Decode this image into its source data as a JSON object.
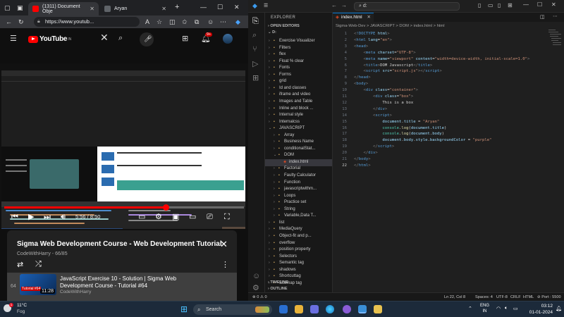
{
  "browser": {
    "tabs": [
      {
        "label": "(1311) Document Obje",
        "fav_color": "#ff0000"
      },
      {
        "label": "Aryan",
        "fav_color": "#888888"
      }
    ],
    "new_tab": "+",
    "window_buttons": {
      "minimize": "—",
      "maximize": "☐",
      "close": "✕"
    },
    "url": "https://www.youtub..."
  },
  "youtube": {
    "logo_text": "YouTube",
    "logo_country": "IN",
    "notification_count": "9+",
    "player": {
      "time": "5:56 / 8:50",
      "progress": 0.674
    },
    "playlist": {
      "title": "Sigma Web Development Course - Web Development Tutorial...",
      "channel_index": "CodeWithHarry - 66/85",
      "item": {
        "index": "64",
        "title": "JavaScript Exercise 10 - Solution | Sigma Web Development Course - Tutorial #64",
        "channel": "CodeWithHarry",
        "duration": "11:28",
        "thumb_text": "Tutorial #64"
      }
    }
  },
  "vscode": {
    "search": "d:",
    "explorer_label": "EXPLORER",
    "open_editors": "OPEN EDITORS",
    "root": "D:",
    "tree": [
      {
        "label": "Exercise Visualizer",
        "level": 1,
        "type": "folder"
      },
      {
        "label": "Filters",
        "level": 1,
        "type": "folder"
      },
      {
        "label": "flex",
        "level": 1,
        "type": "folder"
      },
      {
        "label": "Float % clear",
        "level": 1,
        "type": "folder"
      },
      {
        "label": "Fonts",
        "level": 1,
        "type": "folder"
      },
      {
        "label": "Forms",
        "level": 1,
        "type": "folder"
      },
      {
        "label": "grid",
        "level": 1,
        "type": "folder"
      },
      {
        "label": "Id and classes",
        "level": 1,
        "type": "folder"
      },
      {
        "label": "iframe and video",
        "level": 1,
        "type": "folder"
      },
      {
        "label": "Images and Table",
        "level": 1,
        "type": "folder"
      },
      {
        "label": "Inline and block ...",
        "level": 1,
        "type": "folder"
      },
      {
        "label": "Internal style",
        "level": 1,
        "type": "folder"
      },
      {
        "label": "Internalcss",
        "level": 1,
        "type": "folder"
      },
      {
        "label": "JAVASCRIPT",
        "level": 1,
        "type": "folder-open"
      },
      {
        "label": "Array",
        "level": 2,
        "type": "folder"
      },
      {
        "label": "Business Name",
        "level": 2,
        "type": "folder"
      },
      {
        "label": "conditionalStat...",
        "level": 2,
        "type": "folder"
      },
      {
        "label": "DOM",
        "level": 2,
        "type": "folder-open"
      },
      {
        "label": "index.html",
        "level": 3,
        "type": "html",
        "selected": true
      },
      {
        "label": "Factorial",
        "level": 2,
        "type": "folder"
      },
      {
        "label": "Faulty Calculator",
        "level": 2,
        "type": "folder"
      },
      {
        "label": "Function",
        "level": 2,
        "type": "folder"
      },
      {
        "label": "javascriptwithm...",
        "level": 2,
        "type": "folder"
      },
      {
        "label": "Loops",
        "level": 2,
        "type": "folder"
      },
      {
        "label": "Practice set",
        "level": 2,
        "type": "folder"
      },
      {
        "label": "String",
        "level": 2,
        "type": "folder"
      },
      {
        "label": "Variable,Data T...",
        "level": 2,
        "type": "folder"
      },
      {
        "label": "list",
        "level": 1,
        "type": "folder"
      },
      {
        "label": "MediaQuery",
        "level": 1,
        "type": "folder"
      },
      {
        "label": "Object-fit and p...",
        "level": 1,
        "type": "folder"
      },
      {
        "label": "overflow",
        "level": 1,
        "type": "folder"
      },
      {
        "label": "position property",
        "level": 1,
        "type": "folder"
      },
      {
        "label": "Selectors",
        "level": 1,
        "type": "folder"
      },
      {
        "label": "Semantic tag",
        "level": 1,
        "type": "folder"
      },
      {
        "label": "shadows",
        "level": 1,
        "type": "folder"
      },
      {
        "label": "Shortcuttag",
        "level": 1,
        "type": "folder"
      },
      {
        "label": "Sitemap tag",
        "level": 1,
        "type": "folder"
      }
    ],
    "timeline": "TIMELINE",
    "outline": "OUTLINE",
    "editor_tab": "index.html",
    "breadcrumbs": "Sigma-Web-Dev > JAVASCRIPT > DOM > index.html > html",
    "code": [
      {
        "n": "1",
        "html": "<span class='p'>&lt;</span><span class='t'>!DOCTYPE</span> <span class='a'>html</span><span class='p'>&gt;</span>"
      },
      {
        "n": "2",
        "html": "<span class='p'>&lt;</span><span class='t'>html</span> <span class='a'>lang</span><span class='tx'>=</span><span class='s'>\"en\"</span><span class='p'>&gt;</span>"
      },
      {
        "n": "3",
        "html": "<span class='p'>&lt;</span><span class='t'>head</span><span class='p'>&gt;</span>"
      },
      {
        "n": "4",
        "html": "    <span class='p'>&lt;</span><span class='t'>meta</span> <span class='a'>charset</span><span class='tx'>=</span><span class='s'>\"UTF-8\"</span><span class='p'>&gt;</span>"
      },
      {
        "n": "5",
        "html": "    <span class='p'>&lt;</span><span class='t'>meta</span> <span class='a'>name</span><span class='tx'>=</span><span class='s'>\"viewport\"</span> <span class='a'>content</span><span class='tx'>=</span><span class='s'>\"width=device-width, initial-scale=1.0\"</span><span class='p'>&gt;</span>"
      },
      {
        "n": "6",
        "html": "    <span class='p'>&lt;</span><span class='t'>title</span><span class='p'>&gt;</span><span class='tx'>DOM Javascript</span><span class='p'>&lt;/</span><span class='t'>title</span><span class='p'>&gt;</span>"
      },
      {
        "n": "7",
        "html": "    <span class='p'>&lt;</span><span class='t'>script</span> <span class='a'>src</span><span class='tx'>=</span><span class='s'>\"script.js\"</span><span class='p'>&gt;&lt;/</span><span class='t'>script</span><span class='p'>&gt;</span>"
      },
      {
        "n": "8",
        "html": "<span class='p'>&lt;/</span><span class='t'>head</span><span class='p'>&gt;</span>"
      },
      {
        "n": "9",
        "html": "<span class='p'>&lt;</span><span class='t'>body</span><span class='p'>&gt;</span>"
      },
      {
        "n": "10",
        "html": "    <span class='p'>&lt;</span><span class='t'>div</span> <span class='a'>class</span><span class='tx'>=</span><span class='s'>\"container\"</span><span class='p'>&gt;</span>"
      },
      {
        "n": "11",
        "html": "        <span class='p'>&lt;</span><span class='t'>div</span> <span class='a'>class</span><span class='tx'>=</span><span class='s'>\"box\"</span><span class='p'>&gt;</span>"
      },
      {
        "n": "12",
        "html": "            <span class='tx'>This is a box</span>"
      },
      {
        "n": "13",
        "html": "        <span class='p'>&lt;/</span><span class='t'>div</span><span class='p'>&gt;</span>"
      },
      {
        "n": "14",
        "html": "        <span class='p'>&lt;</span><span class='t'>script</span><span class='p'>&gt;</span>"
      },
      {
        "n": "15",
        "html": "            <span class='a'>document</span><span class='tx'>.</span><span class='a'>title</span> <span class='tx'>=</span> <span class='s'>\"Aryan\"</span>"
      },
      {
        "n": "16",
        "html": "            <span class='k'>console</span><span class='tx'>.</span><span class='y'>log</span><span class='tx'>(</span><span class='a'>document</span><span class='tx'>.</span><span class='a'>title</span><span class='tx'>)</span>"
      },
      {
        "n": "17",
        "html": "            <span class='k'>console</span><span class='tx'>.</span><span class='y'>log</span><span class='tx'>(</span><span class='a'>document</span><span class='tx'>.</span><span class='a'>body</span><span class='tx'>)</span>"
      },
      {
        "n": "18",
        "html": "            <span class='a'>document</span><span class='tx'>.</span><span class='a'>body</span><span class='tx'>.</span><span class='a'>style</span><span class='tx'>.</span><span class='a'>backgroundColor</span> <span class='tx'>=</span> <span class='s'>\"purple\"</span>"
      },
      {
        "n": "19",
        "html": "        <span class='p'>&lt;/</span><span class='t'>script</span><span class='p'>&gt;</span>"
      },
      {
        "n": "20",
        "html": "    <span class='p'>&lt;/</span><span class='t'>div</span><span class='p'>&gt;</span>"
      },
      {
        "n": "21",
        "html": "<span class='p'>&lt;/</span><span class='t'>body</span><span class='p'>&gt;</span>"
      },
      {
        "n": "22",
        "html": "<span class='p'>&lt;/</span><span class='t'>html</span><span class='p'>&gt;</span>"
      }
    ],
    "status": {
      "errors": "⊗ 0 ⚠ 0",
      "cursor": "Ln 22, Col 8",
      "spaces": "Spaces: 4",
      "encoding": "UTF-8",
      "eol": "CRLF",
      "lang": "HTML",
      "port": "⊘ Port : 5500"
    }
  },
  "taskbar": {
    "temp": "11°C",
    "condition": "Fog",
    "weather_badge": "1",
    "search": "Search",
    "lang_top": "ENG",
    "lang_bottom": "IN",
    "time": "03:12",
    "date": "01-01-2024"
  },
  "colors": {
    "yt_red": "#ff0000",
    "vs_accent": "#0078d4",
    "html_icon": "#e44d26"
  }
}
